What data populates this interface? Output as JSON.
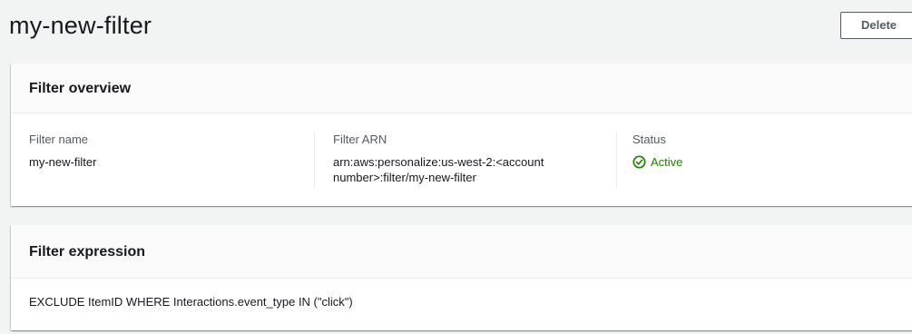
{
  "header": {
    "title": "my-new-filter",
    "delete_label": "Delete"
  },
  "overview": {
    "title": "Filter overview",
    "fields": [
      {
        "label": "Filter name",
        "value": "my-new-filter"
      },
      {
        "label": "Filter ARN",
        "value": "arn:aws:personalize:us-west-2:<account number>:filter/my-new-filter"
      },
      {
        "label": "Status",
        "value": "Active"
      }
    ]
  },
  "expression": {
    "title": "Filter expression",
    "value": "EXCLUDE ItemID WHERE Interactions.event_type IN (\"click\")"
  },
  "colors": {
    "background": "#f2f3f3",
    "status_active": "#1d8102",
    "text": "#16191f",
    "label": "#545b64"
  },
  "icons": {
    "status": "check-circle-icon"
  }
}
